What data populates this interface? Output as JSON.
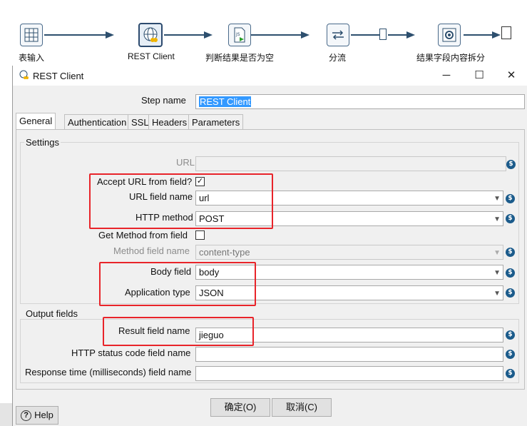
{
  "pipeline": {
    "steps": [
      {
        "label": "表输入",
        "icon": "table-input-icon"
      },
      {
        "label": "REST Client",
        "icon": "rest-client-icon"
      },
      {
        "label": "判断结果是否为空",
        "icon": "javascript-icon"
      },
      {
        "label": "分流",
        "icon": "switch-icon"
      },
      {
        "label": "结果字段内容拆分",
        "icon": "split-icon"
      }
    ]
  },
  "dialog": {
    "title": "REST Client",
    "step_name_label": "Step name",
    "step_name_value": "REST Client",
    "tabs": [
      "General",
      "Authentication",
      "SSL",
      "Headers",
      "Parameters"
    ],
    "settings": {
      "group_title": "Settings",
      "url_label": "URL",
      "url_value": "",
      "accept_url_label": "Accept URL from field?",
      "accept_url_checked": "✓",
      "url_field_label": "URL field name",
      "url_field_value": "url",
      "http_method_label": "HTTP method",
      "http_method_value": "POST",
      "get_method_label": "Get Method from field",
      "method_field_label": "Method field name",
      "method_field_value": "content-type",
      "body_field_label": "Body field",
      "body_field_value": "body",
      "app_type_label": "Application type",
      "app_type_value": "JSON"
    },
    "output": {
      "group_title": "Output fields",
      "result_label": "Result field name",
      "result_value": "jieguo",
      "status_label": "HTTP status code field name",
      "status_value": "",
      "response_time_label": "Response time (milliseconds) field name",
      "response_time_value": ""
    },
    "buttons": {
      "ok": "确定(O)",
      "cancel": "取消(C)",
      "help": "Help"
    }
  },
  "colors": {
    "highlight": "#e8242a",
    "selection": "#3399ff",
    "variable_icon": "#1b5b8b"
  }
}
